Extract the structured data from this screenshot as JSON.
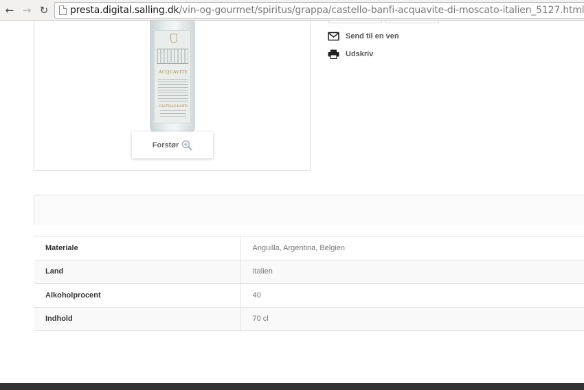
{
  "browser": {
    "url_host": "presta.digital.salling.dk",
    "url_path": "/vin-og-gourmet/spiritus/grappa/castello-banfi-acquavite-di-moscato-italien_5127.html",
    "icons": [
      "back-arrow-icon",
      "forward-arrow-icon",
      "reload-icon",
      "page-icon"
    ]
  },
  "product_image": {
    "zoom_label": "Forstør",
    "zoom_icon": "magnifier-plus-icon"
  },
  "actions": {
    "send_label": "Send til en ven",
    "print_label": "Udskriv"
  },
  "specs": [
    {
      "key": "Materiale",
      "value": "Anguilla, Argentina, Belgien"
    },
    {
      "key": "Land",
      "value": "Italien"
    },
    {
      "key": "Alkoholprocent",
      "value": "40"
    },
    {
      "key": "Indhold",
      "value": "70 cl"
    }
  ],
  "colors": {
    "accent_icon": "#222222",
    "zoom_icon": "#9fb6c4",
    "footer": "#333333"
  }
}
